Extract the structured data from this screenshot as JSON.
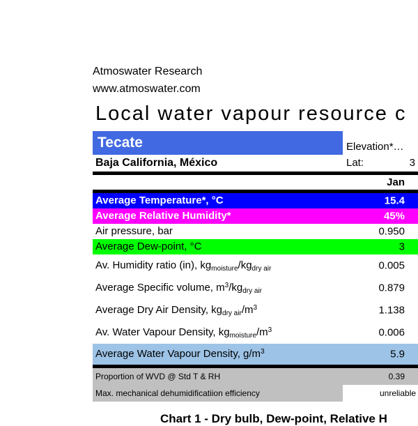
{
  "brand": {
    "name": "Atmoswater Research",
    "url": "www.atmoswater.com"
  },
  "page_title": "Local water vapour resource c",
  "location": {
    "city": "Tecate",
    "region": "Baja California, México",
    "elevation_label": "Elevation*…",
    "lat_label": "Lat:",
    "lat_value": "3"
  },
  "table": {
    "month_header": "Jan",
    "rows": [
      {
        "label": "Average Temperature*, °C",
        "value": "15.4",
        "variant": "row-temp"
      },
      {
        "label": "Average Relative Humidity*",
        "value": "45%",
        "variant": "row-rh"
      },
      {
        "label": "Air pressure, bar",
        "value": "0.950",
        "variant": "row-plain"
      },
      {
        "label": "Average Dew-point, °C",
        "value": "3",
        "variant": "row-dew"
      },
      {
        "label": "Av. Humidity ratio (in), kg<sub>moisture</sub>/kg<sub>dry air</sub>",
        "value": "0.005",
        "variant": "row-plain row-tall"
      },
      {
        "label": "Average Specific volume, m<sup>3</sup>/kg<sub>dry air</sub>",
        "value": "0.879",
        "variant": "row-plain row-tall"
      },
      {
        "label": "Average Dry Air Density, kg<sub>dry air</sub>/m<sup>3</sup>",
        "value": "1.138",
        "variant": "row-plain row-tall"
      },
      {
        "label": "Av. Water Vapour Density, kg<sub>moisture</sub>/m<sup>3</sup>",
        "value": "0.006",
        "variant": "row-plain row-tall"
      },
      {
        "label": "Average Water Vapour Density, g/m<sup>3</sup>",
        "value": "5.9",
        "variant": "row-wvd"
      }
    ],
    "footer_rows": [
      {
        "label": "Proportion of WVD @ Std T & RH",
        "value": "0.39",
        "variant": "row-note"
      },
      {
        "label": "Max. mechanical dehumidificatiion efficiency",
        "value": "unreliable",
        "variant": "row-note",
        "boxed": true
      }
    ]
  },
  "chart_caption": "Chart 1 - Dry bulb, Dew-point, Relative H",
  "colors": {
    "banner_blue": "#4169E1",
    "row_blue": "#0000FF",
    "row_magenta": "#FF00FF",
    "row_green": "#00FF00",
    "row_lightblue": "#9DC3E6",
    "row_gray": "#C0C0C0"
  }
}
